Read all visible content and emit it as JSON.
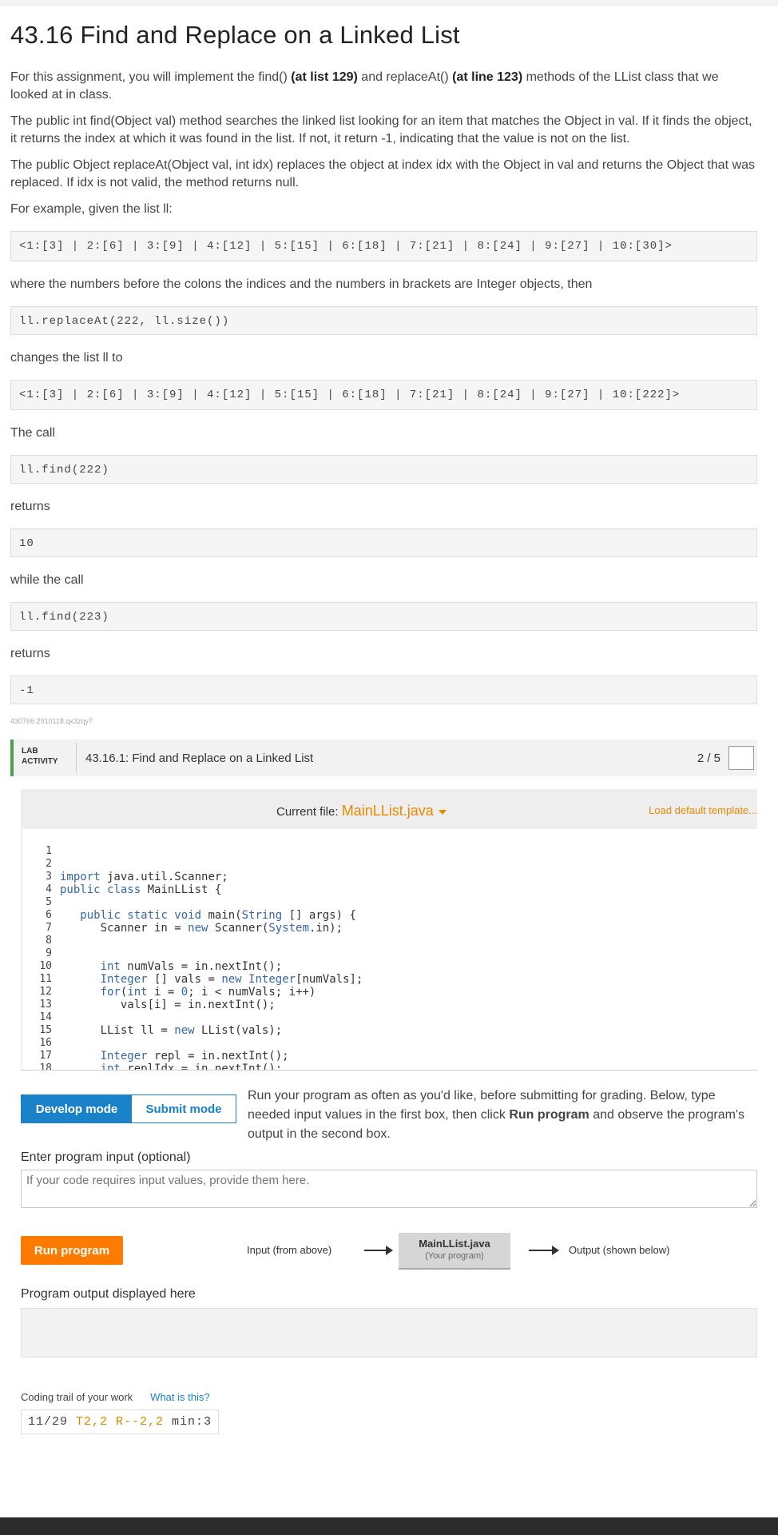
{
  "title": "43.16 Find and Replace on a Linked List",
  "intro": {
    "pre": "For this assignment, you will implement the find() ",
    "b1": "(at list 129)",
    "mid": " and replaceAt() ",
    "b2": "(at line 123)",
    "post": " methods of the LList class that we looked at in class."
  },
  "para_find": "The public int find(Object val) method searches the linked list looking for an item that matches the Object in val. If it finds the object, it returns the index at which it was found in the list. If not, it return -1, indicating that the value is not on the list.",
  "para_replace": "The public Object replaceAt(Object val, int idx) replaces the object at index idx with the Object in val and returns the Object that was replaced. If idx is not valid, the method returns null.",
  "example_intro": "For example, given the list ll:",
  "code_list1": "<1:[3] | 2:[6] | 3:[9] | 4:[12] | 5:[15] | 6:[18] | 7:[21] | 8:[24] | 9:[27] | 10:[30]>",
  "where_text": "where the numbers before the colons the indices and the numbers in brackets are Integer objects, then",
  "code_replace": "ll.replaceAt(222, ll.size())",
  "changes_text": "changes the list ll to",
  "code_list2": "<1:[3] | 2:[6] | 3:[9] | 4:[12] | 5:[15] | 6:[18] | 7:[21] | 8:[24] | 9:[27] | 10:[222]>",
  "the_call": "The call",
  "code_find1": "ll.find(222)",
  "returns1": "returns",
  "code_ret1": "10",
  "while_call": "while the call",
  "code_find2": "ll.find(223)",
  "returns2": "returns",
  "code_ret2": "-1",
  "small_id": "430766.2910118.qx3zqy7",
  "lab": {
    "tag": "LAB ACTIVITY",
    "title": "43.16.1: Find and Replace on a Linked List",
    "score": "2 / 5"
  },
  "editor": {
    "current_file_label": "Current file:",
    "file_name": "MainLList.java",
    "load_default": "Load default template...",
    "line_numbers": [
      "1",
      "2",
      "3",
      "4",
      "5",
      "6",
      "7",
      "8",
      "9",
      "10",
      "11",
      "12",
      "13",
      "14",
      "15",
      "16",
      "17",
      "18"
    ]
  },
  "modes": {
    "develop": "Develop mode",
    "submit": "Submit mode"
  },
  "run_desc_pre": "Run your program as often as you'd like, before submitting for grading. Below, type needed input values in the first box, then click ",
  "run_desc_b": "Run program",
  "run_desc_post": " and observe the program's output in the second box.",
  "input_label": "Enter program input (optional)",
  "input_placeholder": "If your code requires input values, provide them here.",
  "run_button": "Run program",
  "flow": {
    "input": "Input (from above)",
    "prog_name": "MainLList.java",
    "prog_sub": "(Your program)",
    "output": "Output (shown below)"
  },
  "output_label": "Program output displayed here",
  "trail": {
    "label": "Coding trail of your work",
    "link": "What is this?",
    "a": "11/29 ",
    "b": "T2,2 R--2,2",
    "c": " min:3"
  }
}
